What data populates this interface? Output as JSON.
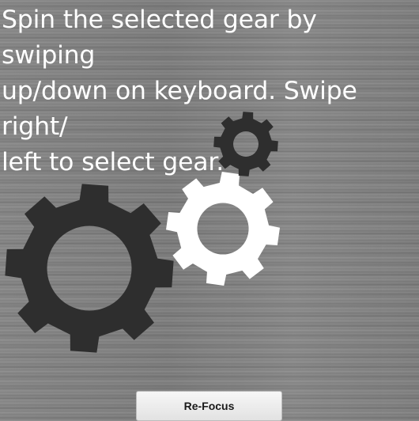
{
  "instructions": {
    "line1": "Spin the selected gear by swiping",
    "line2": "up/down on keyboard. Swipe right/",
    "line3": "left to select gear."
  },
  "gears": [
    {
      "name": "large-gear",
      "color": "#2e2e2e",
      "selected": false
    },
    {
      "name": "selected-gear",
      "color": "#ffffff",
      "selected": true
    },
    {
      "name": "small-gear",
      "color": "#2e2e2e",
      "selected": false
    }
  ],
  "refocus_button": {
    "label": "Re-Focus"
  },
  "colors": {
    "background": "#7f7f7f",
    "gear_dark": "#2e2e2e",
    "gear_selected": "#ffffff",
    "text": "#ffffff"
  }
}
